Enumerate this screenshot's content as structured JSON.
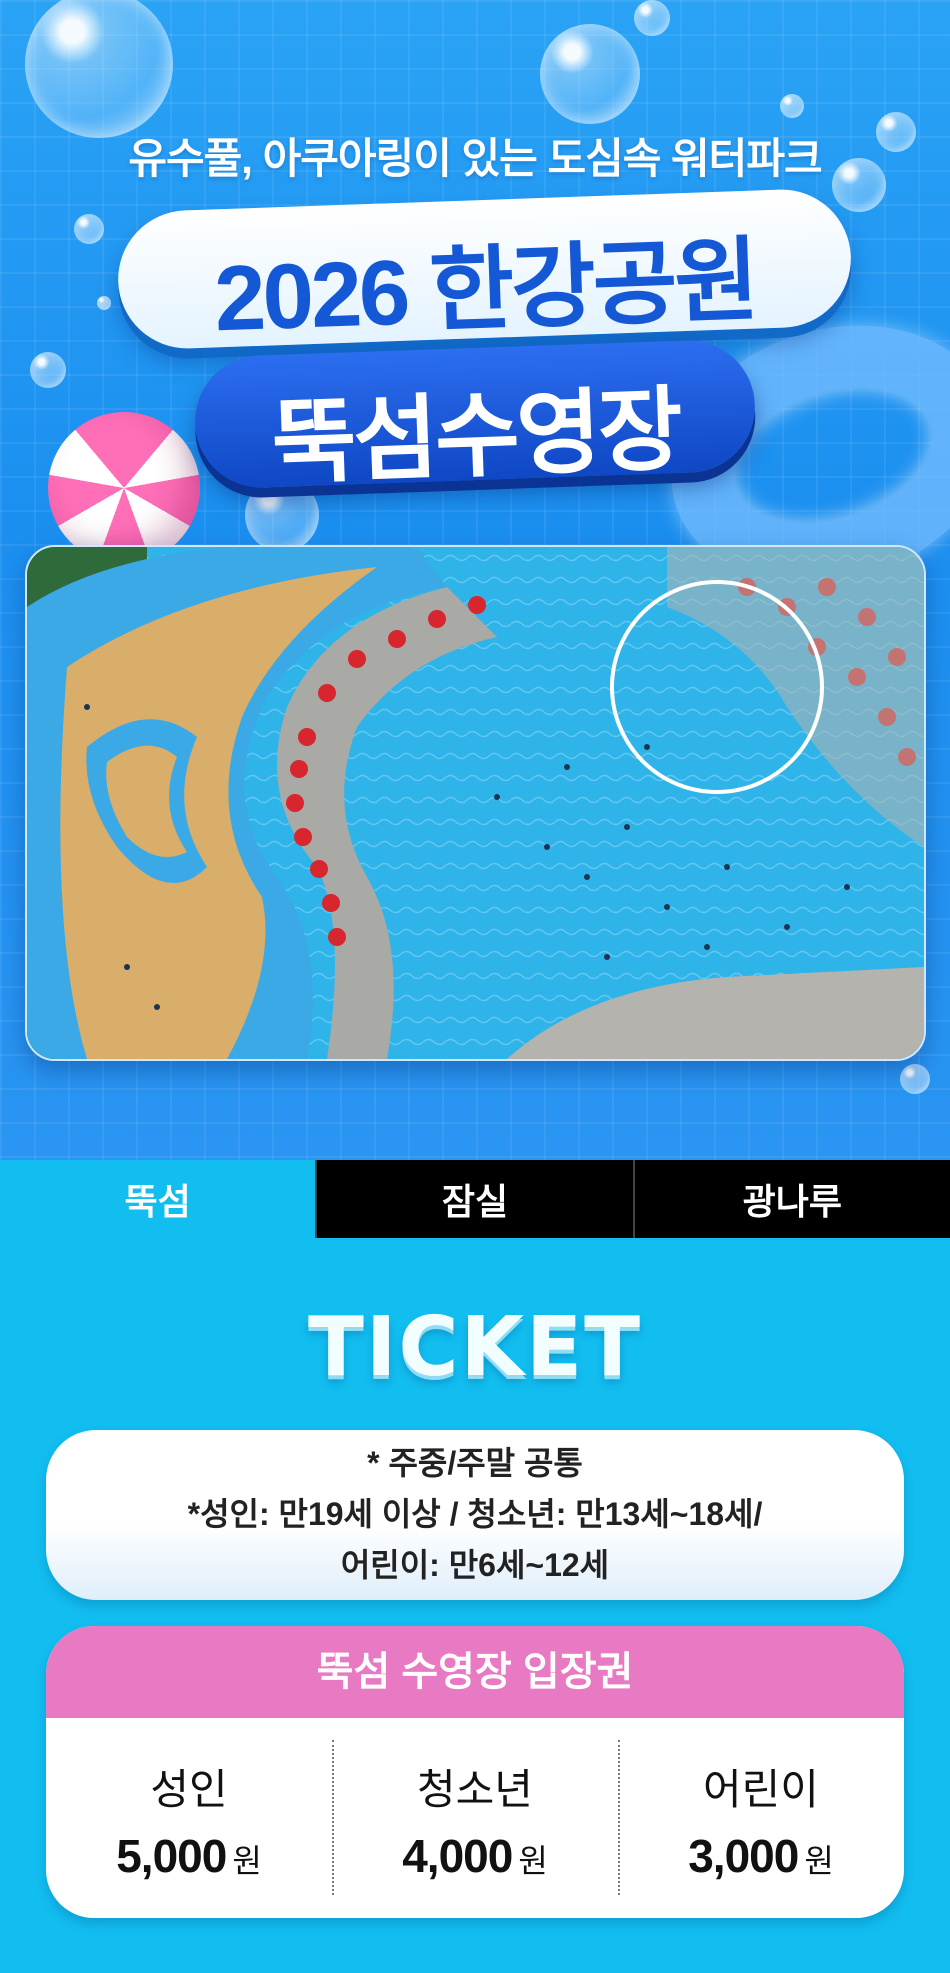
{
  "hero": {
    "subtitle": "유수풀, 아쿠아링이 있는 도심속 워터파크",
    "title_line1": "2026 한강공원",
    "title_line2": "뚝섬수영장"
  },
  "tabs": [
    {
      "label": "뚝섬",
      "active": true
    },
    {
      "label": "잠실",
      "active": false
    },
    {
      "label": "광나루",
      "active": false
    }
  ],
  "ticket": {
    "title": "TICKET",
    "notice_lines": [
      "* 주중/주말 공통",
      "*성인: 만19세 이상 / 청소년: 만13세~18세/",
      "어린이: 만6세~12세"
    ],
    "card_header": "뚝섬 수영장 입장권",
    "prices": [
      {
        "label": "성인",
        "amount": "5,000",
        "unit": "원"
      },
      {
        "label": "청소년",
        "amount": "4,000",
        "unit": "원"
      },
      {
        "label": "어린이",
        "amount": "3,000",
        "unit": "원"
      }
    ]
  },
  "colors": {
    "hero_blue": "#1b8ff0",
    "tab_active": "#12bdf0",
    "tab_inactive": "#000000",
    "card_header_pink": "#e879c3"
  }
}
